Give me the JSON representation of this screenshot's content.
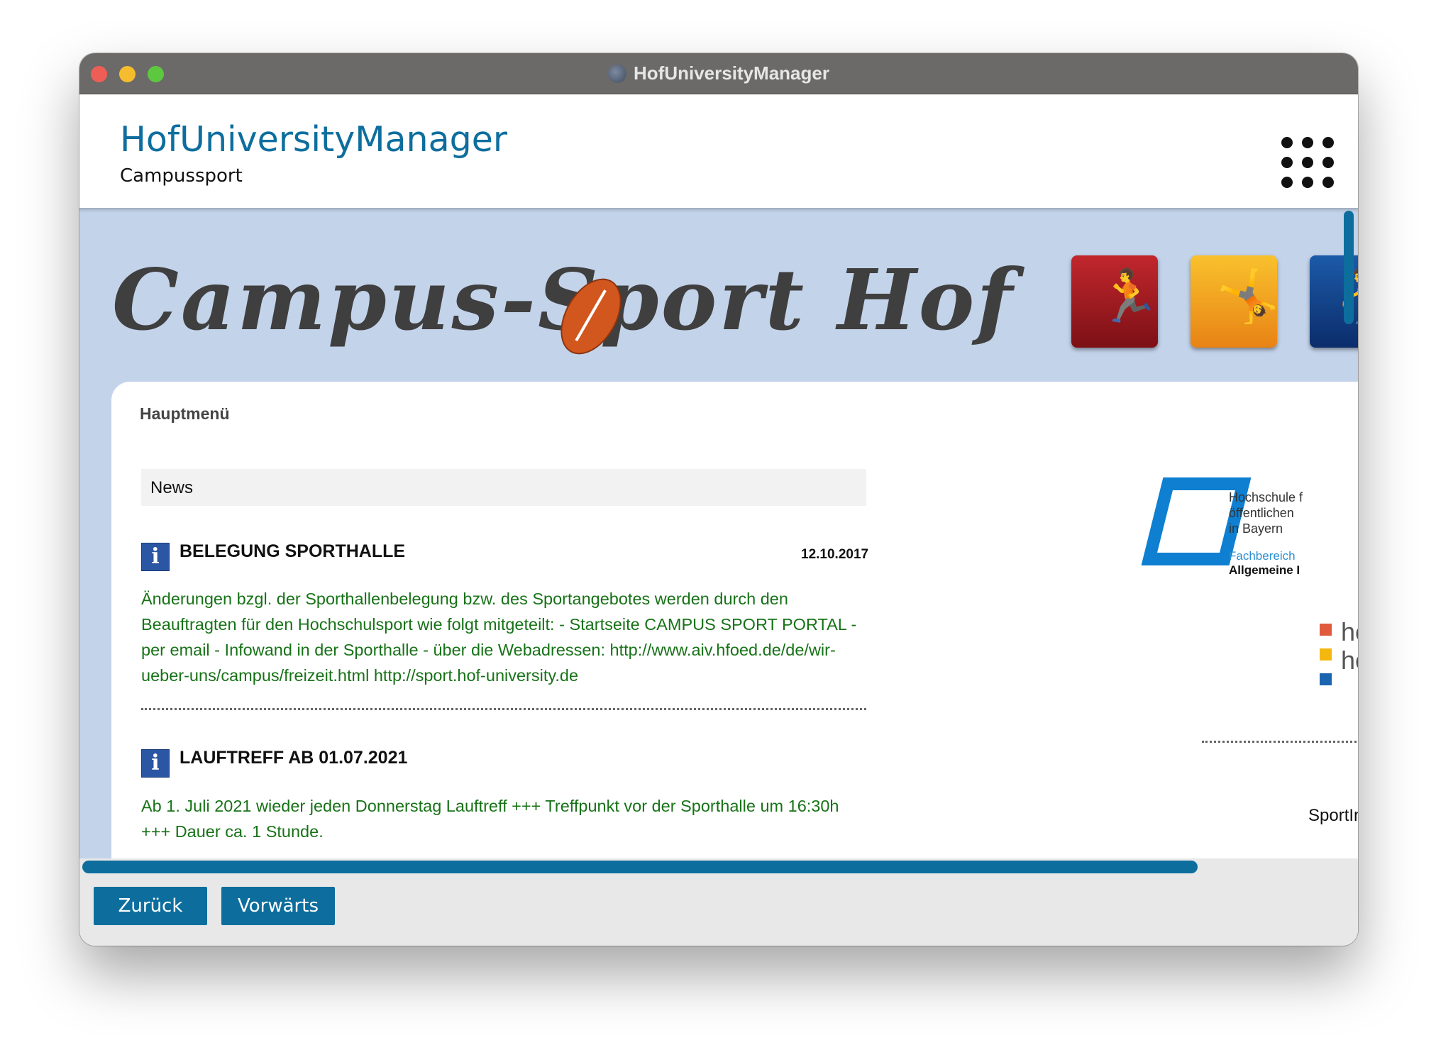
{
  "window": {
    "title": "HofUniversityManager"
  },
  "header": {
    "title": "HofUniversityManager",
    "subtitle": "Campussport",
    "menu_icon": "grid-icon"
  },
  "banner": {
    "title": "Campus-Sport Hof"
  },
  "panel": {
    "heading": "Hauptmenü",
    "section_label": "News",
    "news": [
      {
        "title": "BELEGUNG SPORTHALLE",
        "date": "12.10.2017",
        "body": "Änderungen bzgl. der Sporthallenbelegung bzw. des Sportangebotes werden durch den Beauftragten für den Hochschulsport wie folgt mitgeteilt: - Startseite CAMPUS SPORT PORTAL - per email - Infowand in der Sporthalle - über die Webadressen: http://www.aiv.hfoed.de/de/wir-ueber-uns/campus/freizeit.html http://sport.hof-university.de"
      },
      {
        "title": "LAUFTREFF AB 01.07.2021",
        "date": "",
        "body": "Ab 1. Juli 2021 wieder jeden Donnerstag Lauftreff +++ Treffpunkt vor der Sporthalle um 16:30h +++ Dauer ca. 1 Stunde."
      }
    ]
  },
  "sidebar": {
    "logo_text": [
      "Hochschule f",
      "öffentlichen",
      "in Bayern"
    ],
    "fachbereich": "Fachbereich",
    "allgemeine": "Allgemeine I",
    "hof_text": [
      "ho",
      "ho"
    ],
    "sportinfo": "SportInfo Tipps fü"
  },
  "toolbar": {
    "back_label": "Zurück",
    "forward_label": "Vorwärts"
  },
  "colors": {
    "accent": "#0d6e9e",
    "news_text": "#177217",
    "banner_bg": "#c3d3ea"
  }
}
